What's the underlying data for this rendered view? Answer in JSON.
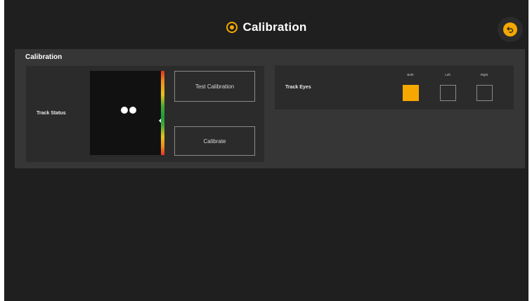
{
  "header": {
    "title": "Calibration",
    "title_icon": "target-icon",
    "back_icon": "back-arrow-icon"
  },
  "panel": {
    "title": "Calibration",
    "track_status": {
      "label": "Track Status"
    },
    "buttons": {
      "test_label": "Test Calibration",
      "calibrate_label": "Calibrate"
    },
    "track_eyes": {
      "label": "Track Eyes",
      "options": [
        {
          "label": "Both",
          "checked": true
        },
        {
          "label": "Left",
          "checked": false
        },
        {
          "label": "Right",
          "checked": false
        }
      ]
    }
  },
  "colors": {
    "accent": "#f5a800",
    "background": "#1f1f1f",
    "panel": "#363636",
    "card": "#2b2b2b"
  }
}
